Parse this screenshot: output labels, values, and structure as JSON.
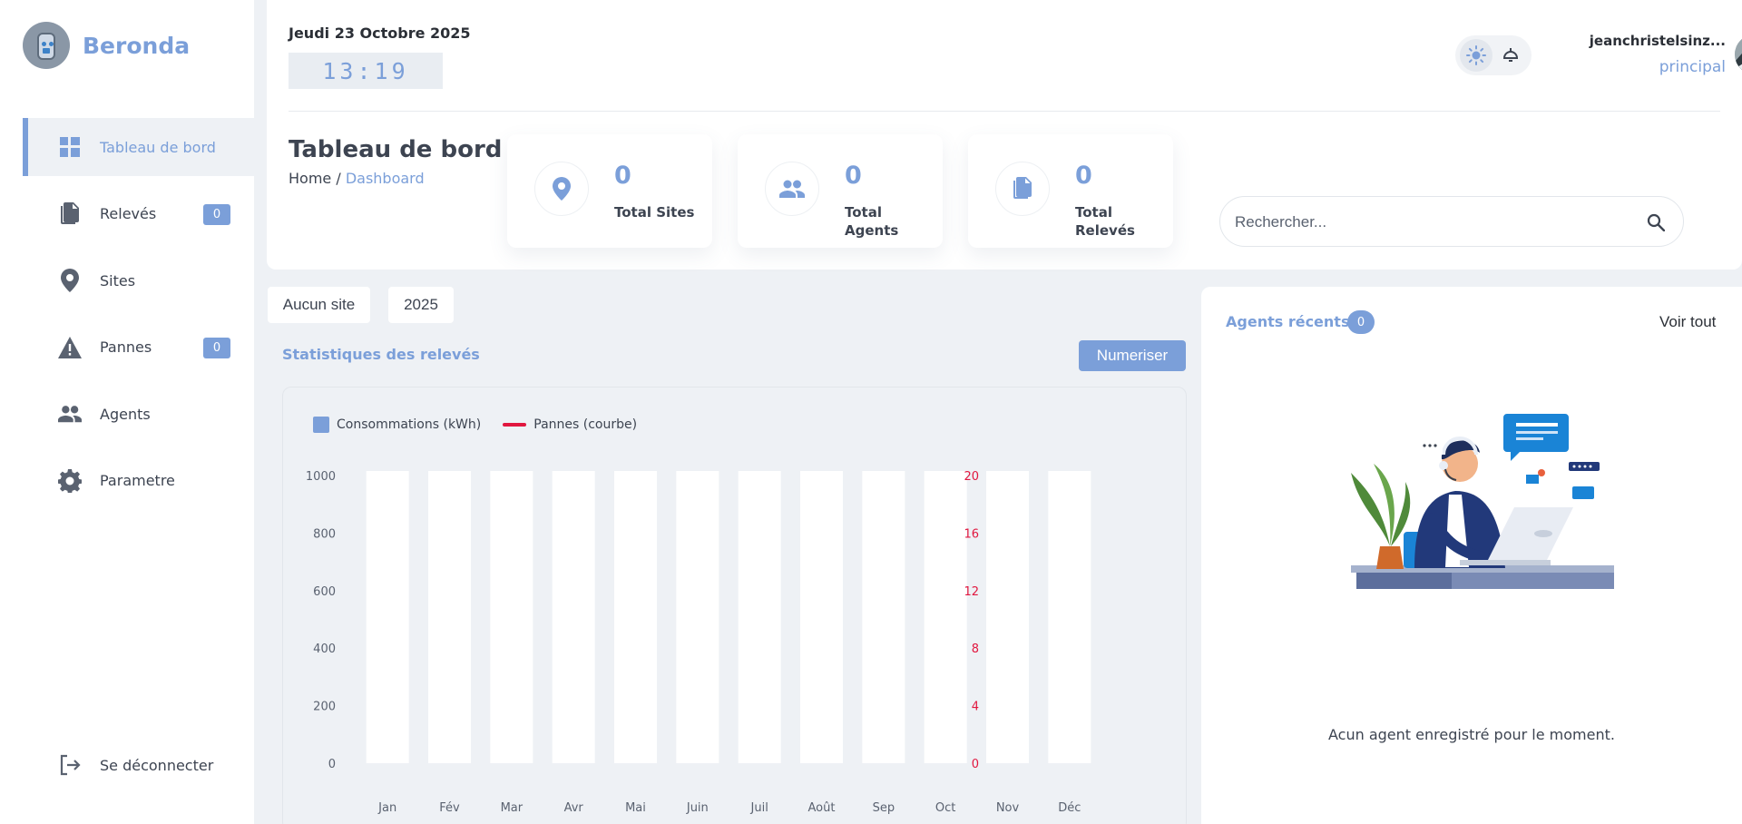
{
  "brand": {
    "name": "Beronda",
    "logo_icon": "robot-icon"
  },
  "sidebar": {
    "items": [
      {
        "label": "Tableau de bord",
        "icon": "dashboard-icon",
        "badge": null,
        "active": true
      },
      {
        "label": "Relevés",
        "icon": "documents-icon",
        "badge": "0",
        "active": false
      },
      {
        "label": "Sites",
        "icon": "location-pin-icon",
        "badge": null,
        "active": false
      },
      {
        "label": "Pannes",
        "icon": "warning-icon",
        "badge": "0",
        "active": false
      },
      {
        "label": "Agents",
        "icon": "people-icon",
        "badge": null,
        "active": false
      },
      {
        "label": "Parametre",
        "icon": "gear-icon",
        "badge": null,
        "active": false
      }
    ],
    "logout_label": "Se déconnecter"
  },
  "header": {
    "date": "Jeudi 23 Octobre 2025",
    "clock": "13:19",
    "user_name": "jeanchristelsinz...",
    "user_role": "principal",
    "page_title": "Tableau de bord",
    "breadcrumb_home": "Home",
    "breadcrumb_sep": "/",
    "breadcrumb_current": "Dashboard",
    "search_placeholder": "Rechercher..."
  },
  "stats": [
    {
      "value": "0",
      "label": "Total Sites",
      "icon": "location-pin-icon"
    },
    {
      "value": "0",
      "label": "Total Agents",
      "icon": "people-icon"
    },
    {
      "value": "0",
      "label": "Total Relevés",
      "icon": "documents-icon"
    }
  ],
  "filters": {
    "site": "Aucun site",
    "year": "2025"
  },
  "statistics": {
    "title": "Statistiques des relevés",
    "button": "Numeriser"
  },
  "chart_data": {
    "type": "bar",
    "categories": [
      "Jan",
      "Fév",
      "Mar",
      "Avr",
      "Mai",
      "Juin",
      "Juil",
      "Août",
      "Sep",
      "Oct",
      "Nov",
      "Déc"
    ],
    "series": [
      {
        "name": "Consommations (kWh)",
        "type": "bar",
        "axis": "left",
        "values": [
          0,
          0,
          0,
          0,
          0,
          0,
          0,
          0,
          0,
          0,
          0,
          0
        ]
      },
      {
        "name": "Pannes (courbe)",
        "type": "line",
        "axis": "right",
        "values": [
          0,
          0,
          0,
          0,
          0,
          0,
          0,
          0,
          0,
          0,
          0,
          0
        ]
      }
    ],
    "y_left": {
      "ticks": [
        0,
        200,
        400,
        600,
        800,
        1000
      ],
      "range": [
        0,
        1000
      ]
    },
    "y_right": {
      "ticks": [
        0,
        4,
        8,
        12,
        16,
        20
      ],
      "range": [
        0,
        20
      ]
    },
    "colors": {
      "bars": "#7b9fd9",
      "line": "#e1173f",
      "right_axis": "#e1173f"
    },
    "legend_position": "top-left"
  },
  "agents": {
    "title": "Agents récents",
    "count": "0",
    "see_all": "Voir tout",
    "empty_message": "Acun agent enregistré pour le moment."
  },
  "colors": {
    "accent": "#7b9fd9",
    "background": "#eef1f5",
    "danger": "#e1173f"
  }
}
